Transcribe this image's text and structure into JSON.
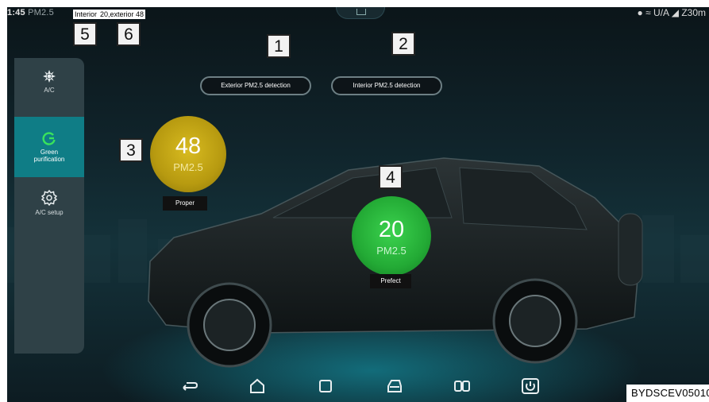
{
  "status_bar": {
    "time": "1:45",
    "pm_label": "PM2.5",
    "right_text": "U/A",
    "signal_text": "Z30m"
  },
  "caption": {
    "interior": "Interior",
    "values": "20,exterior 48"
  },
  "callouts": [
    "1",
    "2",
    "3",
    "4",
    "5",
    "6"
  ],
  "sidebar": {
    "items": [
      {
        "label": "A/C",
        "icon": "fan-icon"
      },
      {
        "label": "Green purification",
        "icon": "green-leaf-refresh-icon",
        "active": true
      },
      {
        "label": "A/C setup",
        "icon": "gear-icon"
      }
    ]
  },
  "buttons": {
    "exterior": "Exterior PM2.5 detection",
    "interior": "Interior PM2.5 detection"
  },
  "exterior_reading": {
    "value": "48",
    "unit": "PM2.5",
    "status": "Proper",
    "color": "#c9a816"
  },
  "interior_reading": {
    "value": "20",
    "unit": "PM2.5",
    "status": "Prefect",
    "color": "#27b63c"
  },
  "nav_bar": {
    "icons": [
      "back-icon",
      "home-icon",
      "recent-apps-icon",
      "car-icon",
      "split-screen-icon",
      "power-icon"
    ]
  },
  "build_id": "BYDSCEV05010"
}
